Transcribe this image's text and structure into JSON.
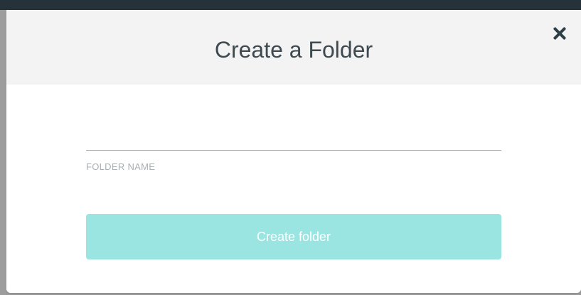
{
  "dialog": {
    "title": "Create a Folder",
    "close_icon": "close-icon",
    "folder_name": {
      "value": "",
      "label": "FOLDER NAME"
    },
    "create_button_label": "Create folder"
  },
  "colors": {
    "backdrop_top": "#26323a",
    "backdrop_side": "#9d9d9d",
    "header_background": "#f3f3f3",
    "title_text": "#3f4a50",
    "input_underline": "#6fc9cf",
    "label_text": "#a8b0b3",
    "button_background": "#9ae4e1",
    "button_text": "#ffffff"
  }
}
